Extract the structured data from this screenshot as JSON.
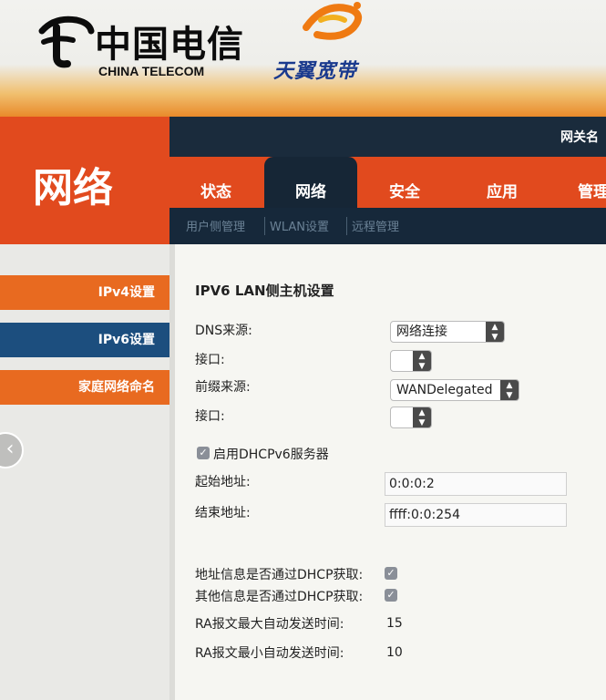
{
  "brand": {
    "cn": "中国电信",
    "en": "CHINA TELECOM",
    "tianyi": "天翼宽带"
  },
  "left_title": "网络",
  "topbar": {
    "gateway_name": "网关名"
  },
  "tabs": [
    {
      "label": "状态",
      "active": false
    },
    {
      "label": "网络",
      "active": true
    },
    {
      "label": "安全",
      "active": false
    },
    {
      "label": "应用",
      "active": false
    },
    {
      "label": "管理",
      "active": false
    }
  ],
  "subnav": [
    "用户侧管理",
    "WLAN设置",
    "远程管理"
  ],
  "sidebar": {
    "items": [
      {
        "label": "IPv4设置",
        "active": false
      },
      {
        "label": "IPv6设置",
        "active": true
      },
      {
        "label": "家庭网络命名",
        "active": false
      }
    ]
  },
  "form": {
    "title": "IPV6 LAN侧主机设置",
    "dns_source_label": "DNS来源:",
    "dns_source_value": "网络连接",
    "interface1_label": "接口:",
    "interface1_value": "",
    "prefix_source_label": "前缀来源:",
    "prefix_source_value": "WANDelegated",
    "interface2_label": "接口:",
    "interface2_value": "",
    "dhcpv6_enable_label": "启用DHCPv6服务器",
    "dhcpv6_enabled": true,
    "start_addr_label": "起始地址:",
    "start_addr_value": "0:0:0:2",
    "end_addr_label": "结束地址:",
    "end_addr_value": "ffff:0:0:254",
    "addr_info_dhcp_label": "地址信息是否通过DHCP获取:",
    "addr_info_dhcp_checked": true,
    "other_info_dhcp_label": "其他信息是否通过DHCP获取:",
    "other_info_dhcp_checked": true,
    "ra_max_label": "RA报文最大自动发送时间:",
    "ra_max_value": "15",
    "ra_min_label": "RA报文最小自动发送时间:",
    "ra_min_value": "10"
  },
  "colors": {
    "orange": "#e14a1e",
    "navy": "#1a2b3c",
    "blue": "#1c4e7e"
  },
  "icons": {
    "back": "chevron-left-icon",
    "check": "checkmark-icon",
    "select": "updown-arrows-icon"
  }
}
